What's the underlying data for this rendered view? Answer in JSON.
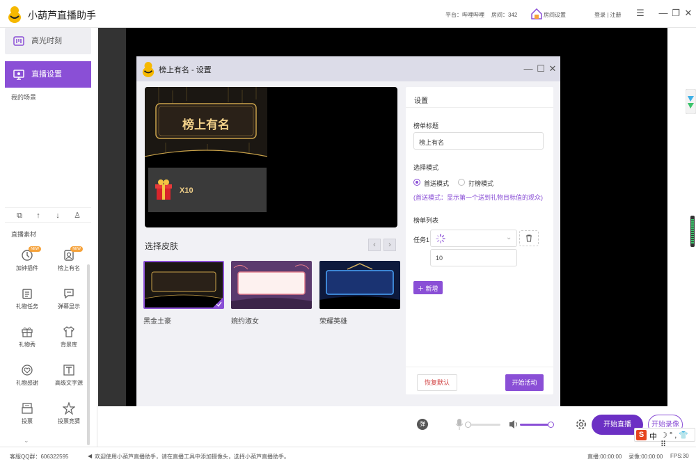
{
  "app": {
    "title": "小葫芦直播助手",
    "platform": "平台：哔哩哔哩",
    "room": "房间：342",
    "room_settings": "房间设置",
    "login": "登录 | 注册"
  },
  "sidebar": {
    "nav": [
      {
        "label": "高光时刻",
        "icon": "highlight-icon"
      },
      {
        "label": "直播设置",
        "icon": "monitor-icon"
      }
    ],
    "scene_label": "我的场景",
    "material_label": "直播素材",
    "new_badge": "NEW",
    "materials": [
      {
        "label": "加钟插件",
        "icon": "clock-plugin-icon",
        "new": true
      },
      {
        "label": "榜上有名",
        "icon": "rank-badge-icon",
        "new": true
      },
      {
        "label": "礼物任务",
        "icon": "gift-task-icon",
        "new": false
      },
      {
        "label": "弹幕显示",
        "icon": "danmaku-icon",
        "new": false
      },
      {
        "label": "礼物秀",
        "icon": "gift-show-icon",
        "new": false
      },
      {
        "label": "背景库",
        "icon": "shirt-icon",
        "new": false
      },
      {
        "label": "礼物感谢",
        "icon": "heart-thanks-icon",
        "new": false
      },
      {
        "label": "高级文字源",
        "icon": "text-source-icon",
        "new": false
      },
      {
        "label": "投票",
        "icon": "vote-icon",
        "new": false
      },
      {
        "label": "投票竞猜",
        "icon": "star-guess-icon",
        "new": false
      }
    ]
  },
  "dialog": {
    "title": "榜上有名 - 设置",
    "preview": {
      "banner": "榜上有名",
      "gift_count": "X10"
    },
    "skin_label": "选择皮肤",
    "skins": [
      {
        "name": "黑金土豪",
        "selected": true
      },
      {
        "name": "婉约淑女",
        "selected": false
      },
      {
        "name": "荣耀英雄",
        "selected": false
      }
    ],
    "settings": {
      "header": "设置",
      "title_label": "榜单标题",
      "title_value": "榜上有名",
      "mode_label": "选择模式",
      "mode_first": "首送模式",
      "mode_rank": "打榜模式",
      "mode_hint": "(首送模式：显示第一个送到礼物目标值的观众)",
      "list_label": "榜单列表",
      "task_label": "任务1",
      "task_value": "10",
      "add_label": "新增",
      "reset_label": "恢复默认",
      "start_label": "开始活动"
    }
  },
  "bottom": {
    "danmaku_icon": "弹",
    "mic_level": 0.0,
    "volume_level": 1.0,
    "start_live": "开始直播",
    "start_record": "开始录像"
  },
  "statusbar": {
    "qq": "客服QQ群：606322595",
    "notice": "欢迎使用小葫芦直播助手，请在直播工具中添加摄像头，选择小葫芦直播助手。",
    "live_time": "直播:00:00:00",
    "record_time": "录像:00:00:00",
    "fps": "FPS:30"
  },
  "ime": {
    "label": "中"
  },
  "colors": {
    "accent": "#8a4fd6",
    "accent_dark": "#6c30c4",
    "stage_bg": "#333333"
  }
}
